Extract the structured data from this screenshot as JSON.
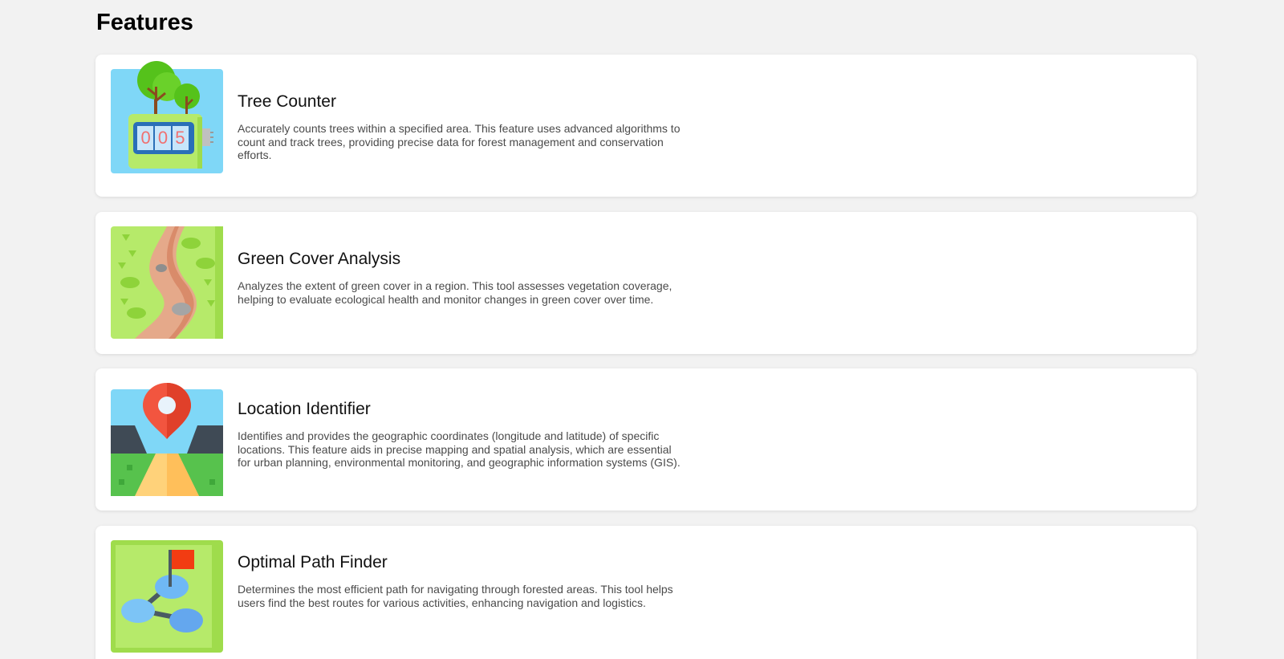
{
  "page": {
    "title": "Features"
  },
  "features": [
    {
      "title": "Tree Counter",
      "description": "Accurately counts trees within a specified area. This feature uses advanced algorithms to count and track trees, providing precise data for forest management and conservation efforts.",
      "icon": "tree-counter-icon",
      "counter_digits": [
        "0",
        "0",
        "5"
      ]
    },
    {
      "title": "Green Cover Analysis",
      "description": "Analyzes the extent of green cover in a region. This tool assesses vegetation coverage, helping to evaluate ecological health and monitor changes in green cover over time.",
      "icon": "green-cover-icon"
    },
    {
      "title": "Location Identifier",
      "description": "Identifies and provides the geographic coordinates (longitude and latitude) of specific locations. This feature aids in precise mapping and spatial analysis, which are essential for urban planning, environmental monitoring, and geographic information systems (GIS).",
      "icon": "location-pin-icon"
    },
    {
      "title": "Optimal Path Finder",
      "description": "Determines the most efficient path for navigating through forested areas. This tool helps users find the best routes for various activities, enhancing navigation and logistics.",
      "icon": "path-finder-icon"
    }
  ],
  "colors": {
    "background": "#f2f2f2",
    "card": "#ffffff",
    "sky": "#7fd7f7",
    "grass": "#b6ea6a",
    "pin": "#f2553f",
    "flag": "#f23c12"
  }
}
